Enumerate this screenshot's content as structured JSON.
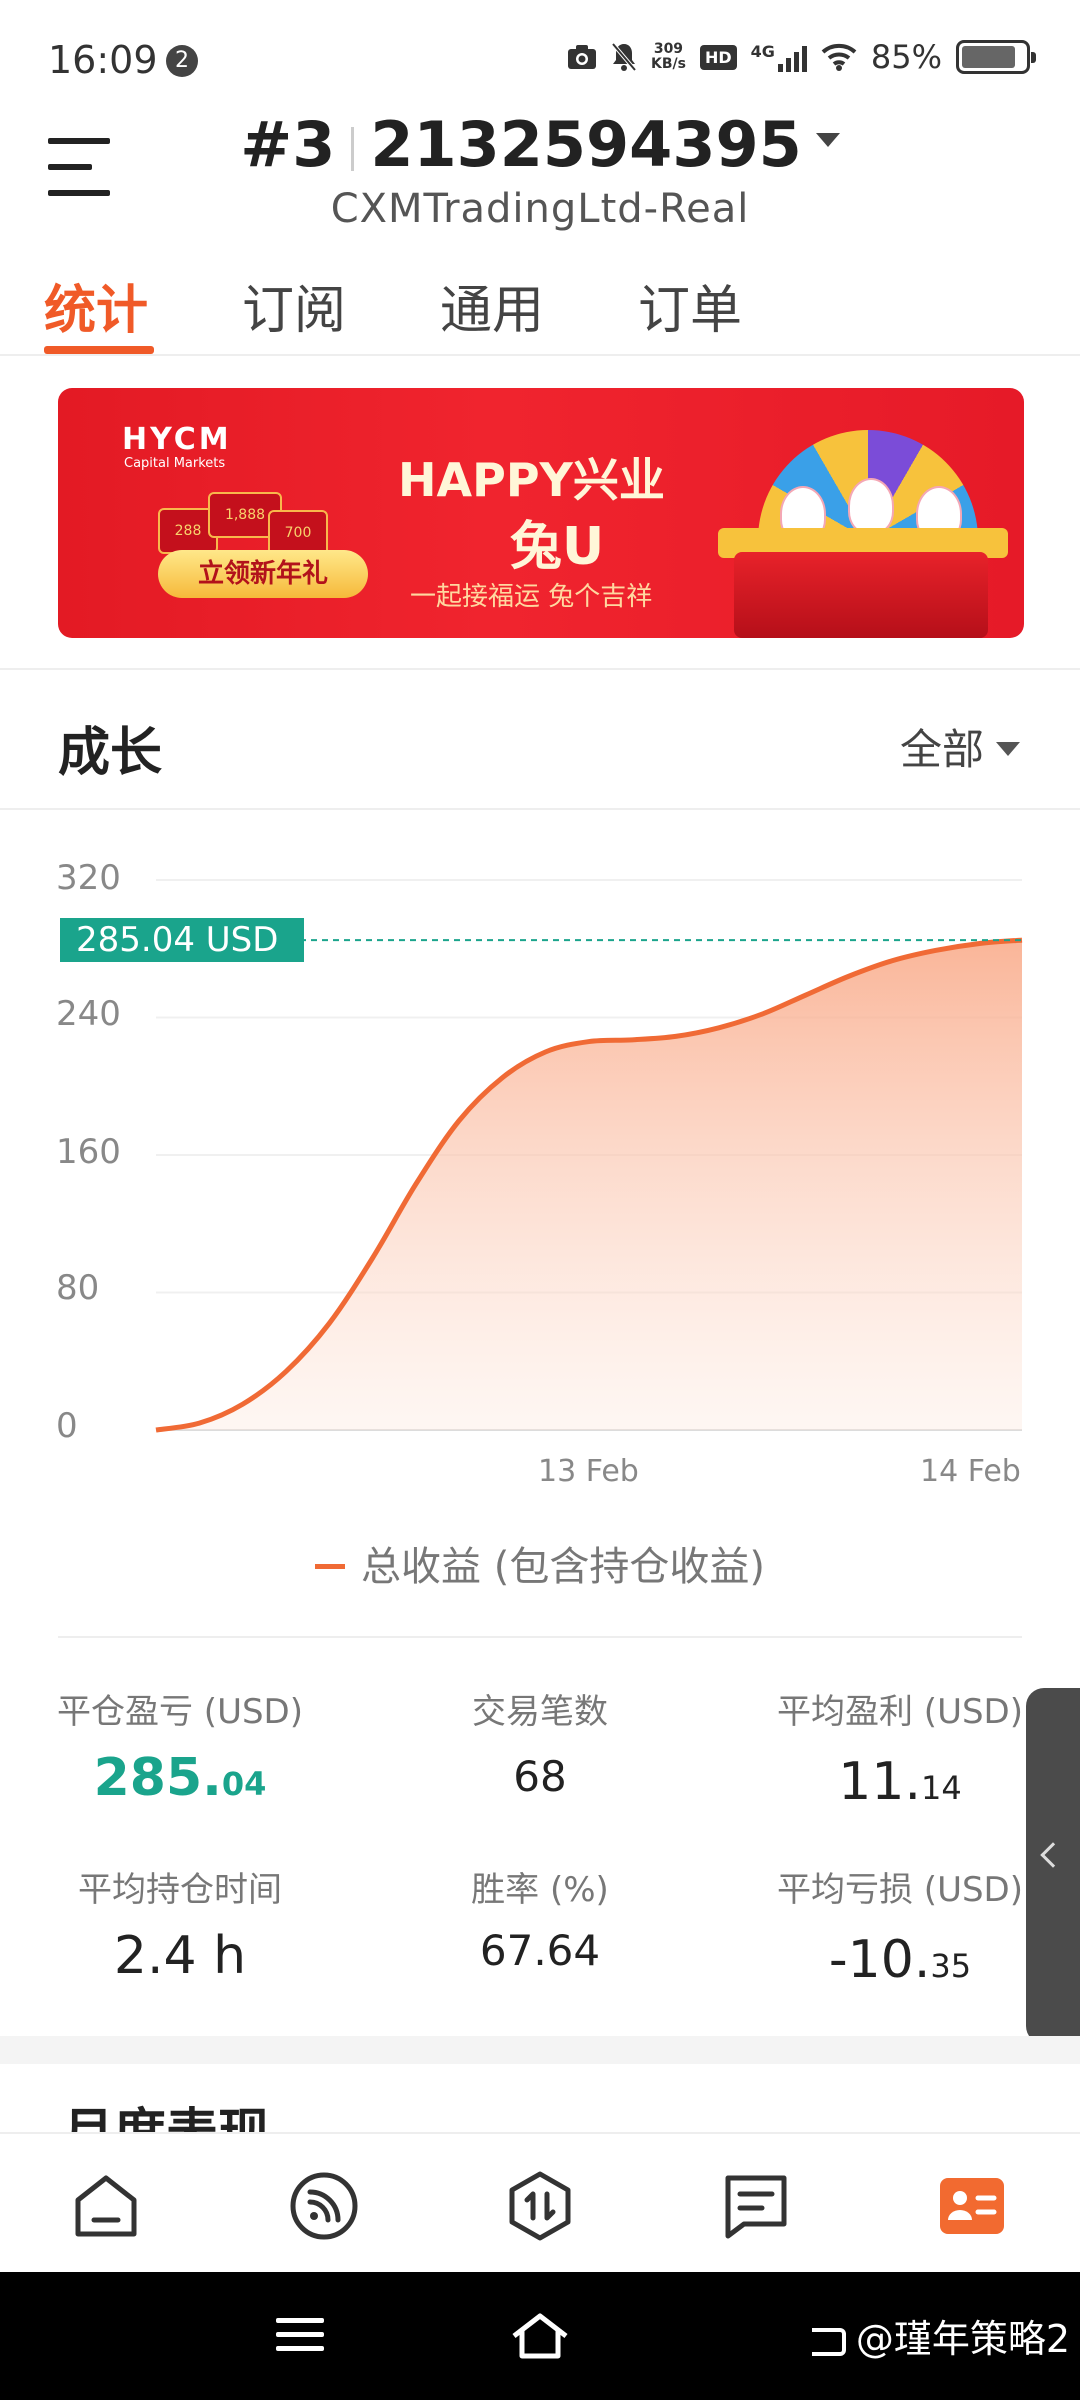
{
  "status_bar": {
    "time": "16:09",
    "notification_count": "2",
    "net_speed_value": "309",
    "net_speed_unit": "KB/s",
    "hd_label": "HD",
    "network": "4G",
    "battery_percent": "85%",
    "battery_level": 0.85
  },
  "header": {
    "account_prefix": "#3",
    "account_number": "2132594395",
    "server_name": "CXMTradingLtd-Real"
  },
  "tabs": [
    {
      "label": "统计",
      "active": true
    },
    {
      "label": "订阅",
      "active": false
    },
    {
      "label": "通用",
      "active": false
    },
    {
      "label": "订单",
      "active": false
    }
  ],
  "banner": {
    "logo": "HYCM",
    "logo_sub": "Capital Markets",
    "envelope_values": [
      "288",
      "1,888",
      "700"
    ],
    "cta": "立领新年礼",
    "title_line1": "HAPPY兴业",
    "title_line2": "兔U",
    "subtitle": "一起接福运 兔个吉祥"
  },
  "growth": {
    "title": "成长",
    "filter": "全部"
  },
  "chart_data": {
    "type": "area",
    "y_ticks": [
      "320",
      "240",
      "160",
      "80",
      "0"
    ],
    "ylim": [
      0,
      320
    ],
    "x_tick_labels": [
      "13 Feb",
      "14 Feb"
    ],
    "current_value_label": "285.04 USD",
    "current_value": 285.04,
    "legend": "总收益 (包含持仓收益)",
    "series": [
      {
        "name": "总收益 (包含持仓收益)",
        "values": [
          0,
          4,
          15,
          34,
          62,
          100,
          143,
          180,
          205,
          220,
          226,
          227,
          229,
          234,
          242,
          253,
          264,
          273,
          279,
          283,
          285.04
        ]
      }
    ],
    "colors": {
      "line": "#f06a35",
      "fill": "#f9b398",
      "marker": "#1aa48c"
    }
  },
  "stats": {
    "closed_pnl": {
      "label": "平仓盈亏 (USD)",
      "int": "285.",
      "frac": "04"
    },
    "trade_count": {
      "label": "交易笔数",
      "value": "68"
    },
    "avg_profit": {
      "label": "平均盈利 (USD)",
      "int": "11.",
      "frac": "14"
    },
    "avg_hold_time": {
      "label": "平均持仓时间",
      "value": "2.4 h"
    },
    "win_rate": {
      "label": "胜率 (%)",
      "value": "67.64"
    },
    "avg_loss": {
      "label": "平均亏损 (USD)",
      "int": "-10.",
      "frac": "35"
    }
  },
  "next_section_title": "月度表现",
  "bottom_nav": [
    "home-icon",
    "feed-icon",
    "trade-icon",
    "message-icon",
    "profile-card-icon"
  ],
  "accent_color": "#f05a28",
  "watermark": "@瑾年策略2"
}
